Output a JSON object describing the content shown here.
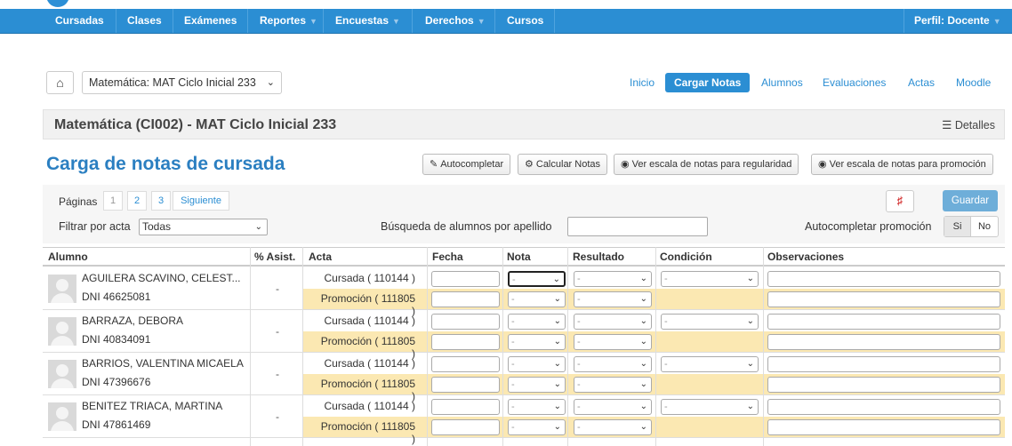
{
  "navbar": {
    "items": [
      {
        "label": "Cursadas",
        "dropdown": false
      },
      {
        "label": "Clases",
        "dropdown": false
      },
      {
        "label": "Exámenes",
        "dropdown": false
      },
      {
        "label": "Reportes",
        "dropdown": true
      },
      {
        "label": "Encuestas",
        "dropdown": true
      },
      {
        "label": "Derechos",
        "dropdown": true
      },
      {
        "label": "Cursos",
        "dropdown": false
      }
    ],
    "profile": "Perfil: Docente"
  },
  "toolbar": {
    "home_icon": "home-icon",
    "materia_select": "Matemática: MAT Ciclo Inicial 233",
    "nav": [
      "Inicio",
      "Cargar Notas",
      "Alumnos",
      "Evaluaciones",
      "Actas",
      "Moodle"
    ],
    "active_nav": "Cargar Notas"
  },
  "course": {
    "title": "Matemática (CI002) - MAT Ciclo Inicial 233",
    "details": "Detalles"
  },
  "page": {
    "title": "Carga de notas de cursada",
    "buttons": {
      "autocompletar": "Autocompletar",
      "calcular": "Calcular Notas",
      "escala_regularidad": "Ver escala de notas para regularidad",
      "escala_promocion": "Ver escala de notas para promoción"
    }
  },
  "filters": {
    "paginas_label": "Páginas",
    "pages": [
      "1",
      "2",
      "3"
    ],
    "next": "Siguiente",
    "filtrar_label": "Filtrar por acta",
    "acta_selected": "Todas",
    "search_label": "Búsqueda de alumnos por apellido",
    "search_value": "",
    "autocompletar_promo_label": "Autocompletar promoción",
    "toggle_si": "Si",
    "toggle_no": "No",
    "guardar": "Guardar"
  },
  "table": {
    "headers": [
      "Alumno",
      "% Asist.",
      "Acta",
      "Fecha",
      "Nota",
      "Resultado",
      "Condición",
      "Observaciones"
    ],
    "acta_cursada": "Cursada ( 110144 )",
    "acta_promocion": "Promoción ( 111805 )",
    "select_placeholder": "-",
    "students": [
      {
        "name": "AGUILERA SCAVINO, CELEST...",
        "dni": "DNI 46625081",
        "asist": "-"
      },
      {
        "name": "BARRAZA, DEBORA",
        "dni": "DNI 40834091",
        "asist": "-"
      },
      {
        "name": "BARRIOS, VALENTINA MICAELA",
        "dni": "DNI 47396676",
        "asist": "-"
      },
      {
        "name": "BENITEZ TRIACA, MARTINA",
        "dni": "DNI 47861469",
        "asist": "-"
      }
    ]
  },
  "colors": {
    "navbar": "#2b8ed3",
    "promo_row": "#fbe8b2",
    "title": "#2b7fc1",
    "guardar": "#6eaed9"
  }
}
